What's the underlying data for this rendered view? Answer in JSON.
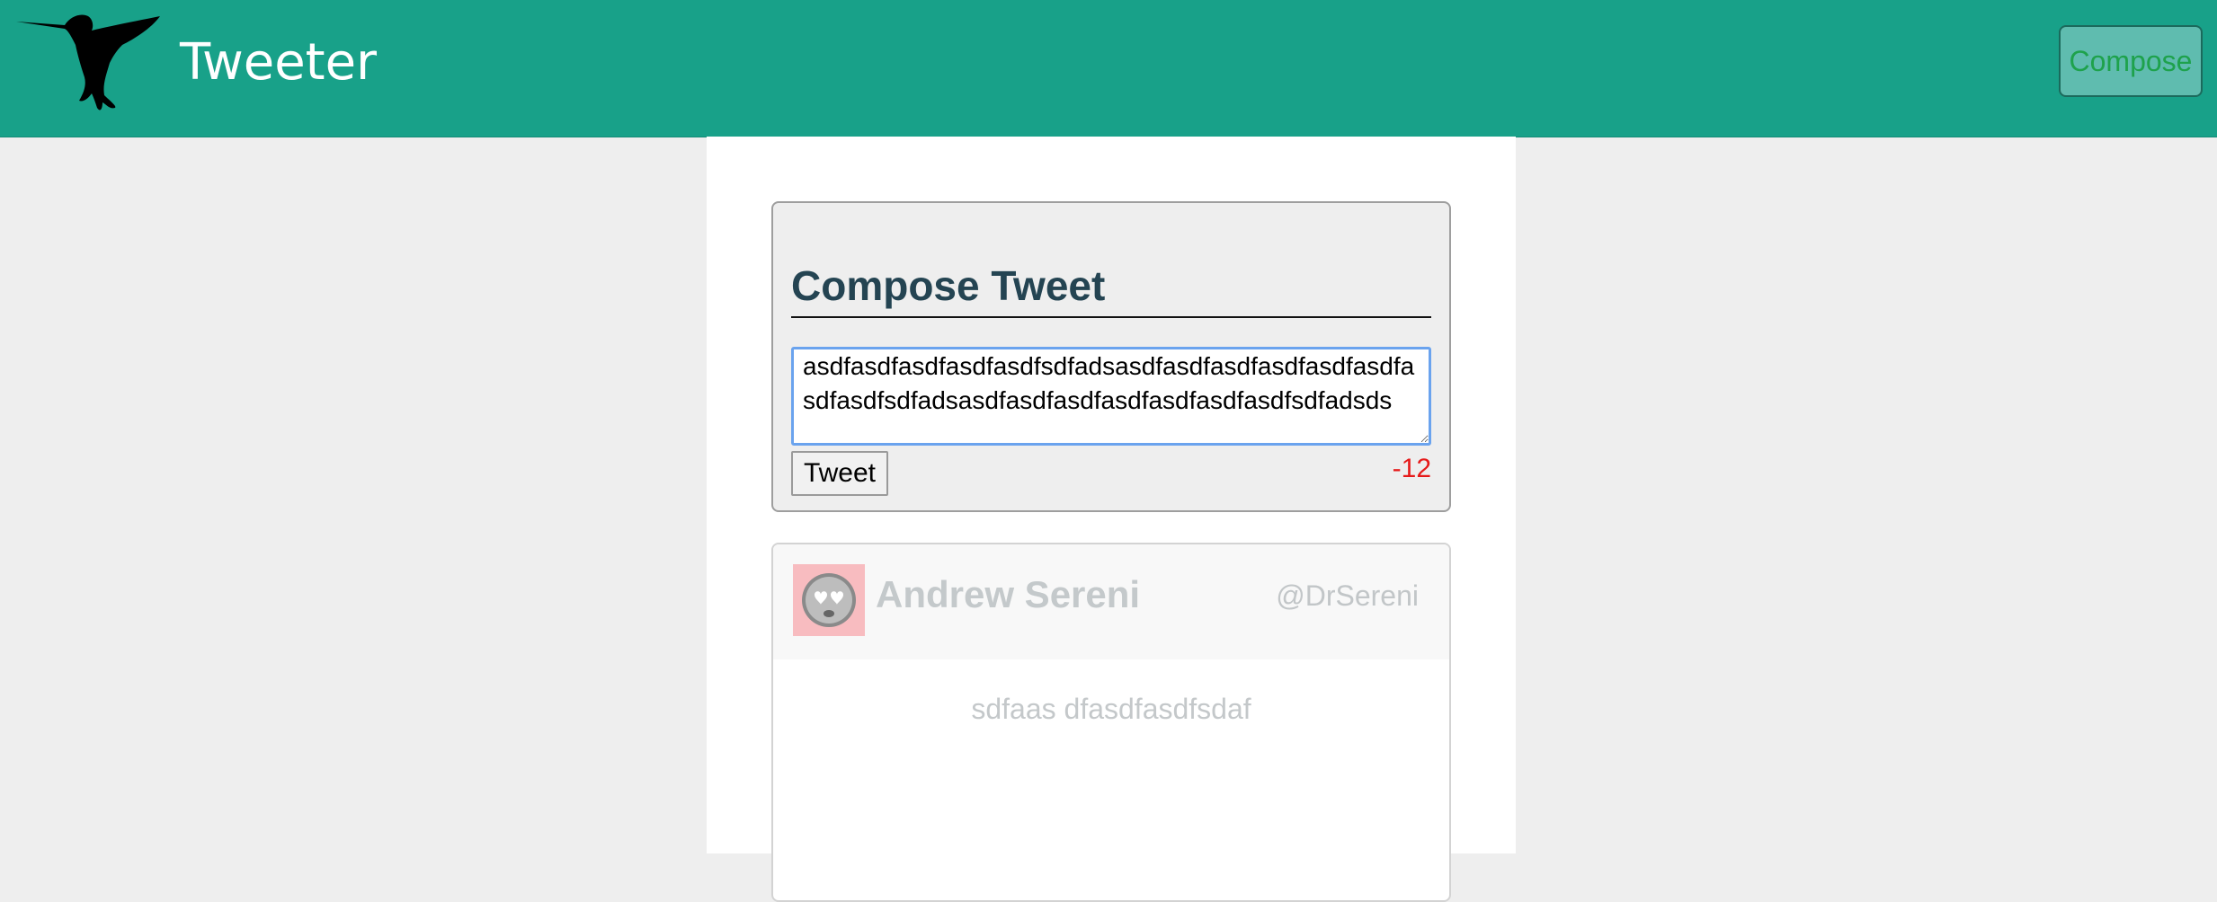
{
  "navbar": {
    "logo_icon": "hummingbird-icon",
    "brand": "Tweeter",
    "compose_label": "Compose",
    "background_color": "#18a189"
  },
  "compose": {
    "title": "Compose Tweet",
    "text_value": "asdfasdfasdfasdfasdfsdfadsasdfasdfasdfasdfasdfasdfasdfasdfsdfadsasdfasdfasdfasdfasdfasdfasdfsdfadsds",
    "tweet_label": "Tweet",
    "counter": "-12",
    "counter_color": "#e61a1a"
  },
  "tweets": [
    {
      "avatar_icon": "heart-eyes-emoji-avatar",
      "name": "Andrew Sereni",
      "handle": "@DrSereni",
      "content": "sdfaas dfasdfasdfsdaf"
    }
  ]
}
